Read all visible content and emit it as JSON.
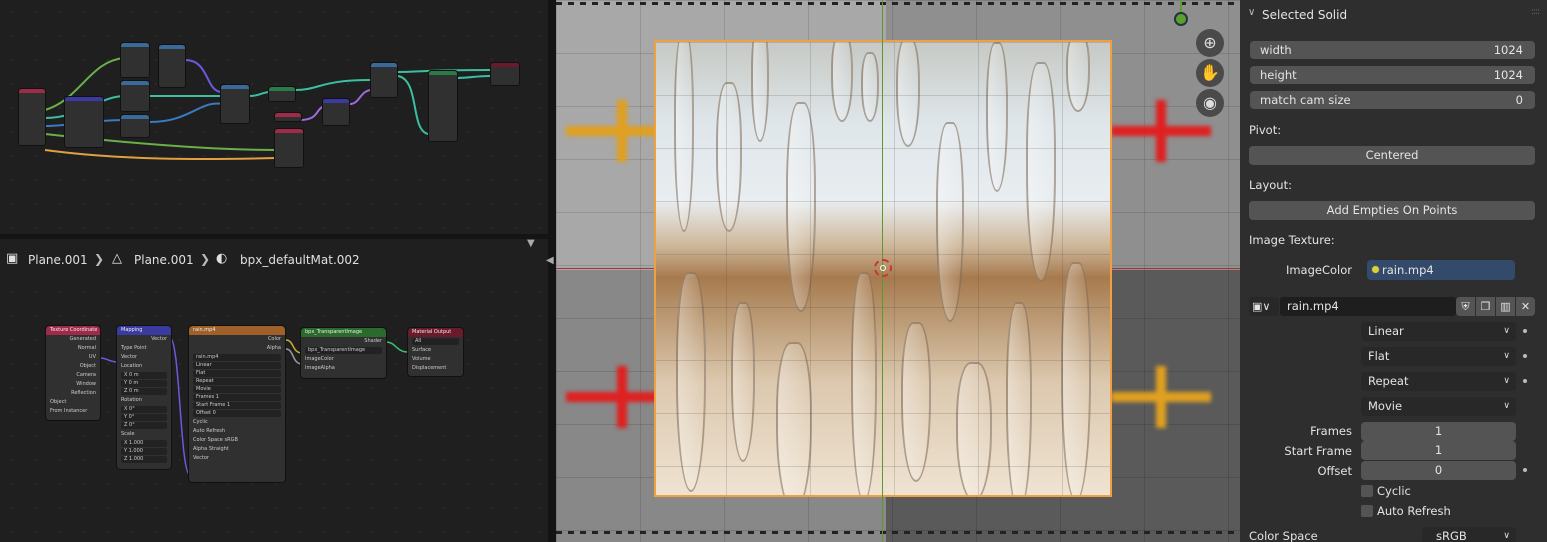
{
  "node_editor": {
    "breadcrumb": {
      "object": "Plane.001",
      "mesh": "Plane.001",
      "material": "bpx_defaultMat.002"
    },
    "nodes": {
      "texcoord": {
        "title": "Texture Coordinate",
        "outputs": [
          "Generated",
          "Normal",
          "UV",
          "Object",
          "Camera",
          "Window",
          "Reflection"
        ],
        "object_label": "Object",
        "from_instancer": "From Instancer"
      },
      "mapping": {
        "title": "Mapping",
        "output": "Vector",
        "type_label": "Type",
        "type_value": "Point",
        "vector": "Vector",
        "location": "Location",
        "rotation": "Rotation",
        "scale": "Scale",
        "loc": [
          "0 m",
          "0 m",
          "0 m"
        ],
        "rot": [
          "0°",
          "0°",
          "0°"
        ],
        "scl": [
          "1.000",
          "1.000",
          "1.000"
        ],
        "axes": [
          "X",
          "Y",
          "Z"
        ]
      },
      "image": {
        "title": "rain.mp4",
        "outputs": [
          "Color",
          "Alpha"
        ],
        "file": "rain.mp4",
        "interp": "Linear",
        "proj": "Flat",
        "ext": "Repeat",
        "source": "Movie",
        "frames_label": "Frames",
        "frames": "1",
        "start_label": "Start Frame",
        "start": "1",
        "offset_label": "Offset",
        "offset": "0",
        "cyclic": "Cyclic",
        "autorefresh": "Auto Refresh",
        "cs_label": "Color Space",
        "cs": "sRGB",
        "alpha_label": "Alpha",
        "alpha": "Straight",
        "vector": "Vector"
      },
      "group": {
        "title": "bpx_TransparentImage",
        "output": "Shader",
        "name": "bpx_TransparentImage",
        "inputs": [
          "ImageColor",
          "ImageAlpha"
        ]
      },
      "output": {
        "title": "Material Output",
        "target": "All",
        "inputs": [
          "Surface",
          "Volume",
          "Displacement"
        ]
      }
    }
  },
  "sidebar": {
    "panel_title": "Selected Solid",
    "width_label": "width",
    "width_value": "1024",
    "height_label": "height",
    "height_value": "1024",
    "match_label": "match cam size",
    "match_value": "0",
    "pivot_label": "Pivot:",
    "pivot_value": "Centered",
    "layout_label": "Layout:",
    "layout_button": "Add Empties On Points",
    "imgtex_label": "Image Texture:",
    "imagecolor_label": "ImageColor",
    "imagecolor_value": "rain.mp4",
    "image_name": "rain.mp4",
    "interpolation": "Linear",
    "projection": "Flat",
    "extension": "Repeat",
    "source": "Movie",
    "frames_label": "Frames",
    "frames_value": "1",
    "start_label": "Start Frame",
    "start_value": "1",
    "offset_label": "Offset",
    "offset_value": "0",
    "cyclic_label": "Cyclic",
    "autorefresh_label": "Auto Refresh",
    "colorspace_label": "Color Space",
    "colorspace_value": "sRGB"
  },
  "colors": {
    "selection_outline": "#f0a040",
    "x_axis": "#aa3333",
    "y_axis": "#5a9a2a",
    "slot_bg": "#334a6a",
    "texcoord_header": "#a02a4a",
    "mapping_header": "#3a3aa0",
    "image_header": "#a0602a",
    "group_header": "#2a6a2a",
    "output_header": "#6a1a2a"
  },
  "icons": {
    "zoom": "zoom-in-icon",
    "pan": "hand-icon",
    "camera": "camera-icon",
    "image_type": "image-icon",
    "fake_user": "shield-icon",
    "duplicate": "duplicate-icon",
    "open": "folder-icon",
    "unlink": "close-icon"
  }
}
